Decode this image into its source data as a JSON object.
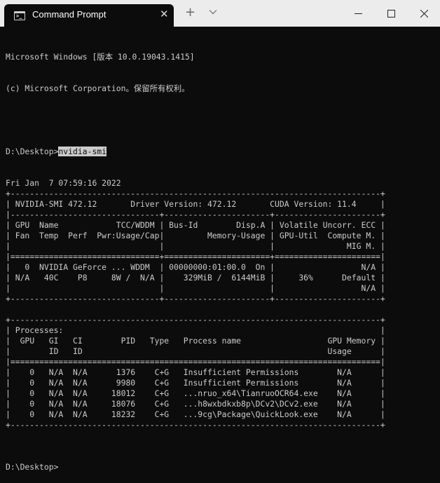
{
  "window": {
    "tab_title": "Command Prompt",
    "close_tab_glyph": "✕",
    "new_tab_glyph": "+",
    "icons": [
      "command-prompt-icon",
      "close-icon",
      "plus-icon",
      "chevron-down-icon",
      "minimize-icon",
      "maximize-icon",
      "window-close-icon"
    ]
  },
  "terminal": {
    "banner": [
      "Microsoft Windows [版本 10.0.19043.1415]",
      "(c) Microsoft Corporation。保留所有权利。"
    ],
    "prompt": "D:\\Desktop>",
    "command": "nvidia-smi",
    "output": [
      "Fri Jan  7 07:59:16 2022",
      "+-----------------------------------------------------------------------------+",
      "| NVIDIA-SMI 472.12       Driver Version: 472.12       CUDA Version: 11.4     |",
      "|-------------------------------+----------------------+----------------------+",
      "| GPU  Name            TCC/WDDM | Bus-Id        Disp.A | Volatile Uncorr. ECC |",
      "| Fan  Temp  Perf  Pwr:Usage/Cap|         Memory-Usage | GPU-Util  Compute M. |",
      "|                               |                      |               MIG M. |",
      "|===============================+======================+======================|",
      "|   0  NVIDIA GeForce ... WDDM  | 00000000:01:00.0  On |                  N/A |",
      "| N/A   40C    P8     8W /  N/A |    329MiB /  6144MiB |     36%      Default |",
      "|                               |                      |                  N/A |",
      "+-------------------------------+----------------------+----------------------+",
      "",
      "+-----------------------------------------------------------------------------+",
      "| Processes:                                                                  |",
      "|  GPU   GI   CI        PID   Type   Process name                  GPU Memory |",
      "|        ID   ID                                                   Usage      |",
      "|=============================================================================|",
      "|    0   N/A  N/A      1376    C+G   Insufficient Permissions        N/A      |",
      "|    0   N/A  N/A      9980    C+G   Insufficient Permissions        N/A      |",
      "|    0   N/A  N/A     18012    C+G   ...nruo_x64\\TianruoOCR64.exe    N/A      |",
      "|    0   N/A  N/A     18076    C+G   ...h8wxbdkxb8p\\DCv2\\DCv2.exe    N/A      |",
      "|    0   N/A  N/A     18232    C+G   ...9cg\\Package\\QuickLook.exe    N/A      |",
      "+-----------------------------------------------------------------------------+",
      ""
    ],
    "final_prompt": "D:\\Desktop>"
  }
}
